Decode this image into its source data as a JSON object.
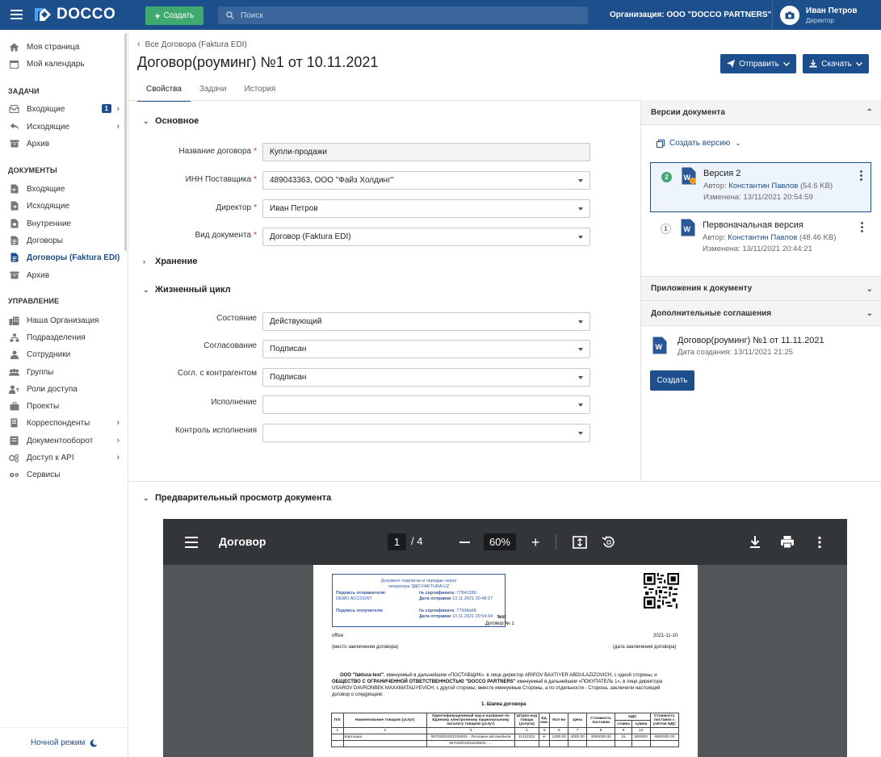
{
  "topbar": {
    "logo": "DOCCO",
    "create_label": "Создать",
    "search_placeholder": "Поиск",
    "org_label": "Организация: ООО \"DOCCO PARTNERS\"",
    "user_name": "Иван Петров",
    "user_role": "Директор"
  },
  "sidebar": {
    "top_items": [
      {
        "label": "Моя страница",
        "icon": "home-icon"
      },
      {
        "label": "Мой календарь",
        "icon": "calendar-icon"
      }
    ],
    "tasks_header": "ЗАДАЧИ",
    "tasks_items": [
      {
        "label": "Входящие",
        "icon": "inbox-icon",
        "badge": "1"
      },
      {
        "label": "Исходящие",
        "icon": "reply-icon"
      },
      {
        "label": "Архив",
        "icon": "archive-icon"
      }
    ],
    "docs_header": "ДОКУМЕНТЫ",
    "docs_items": [
      {
        "label": "Входящие",
        "icon": "doc-in-icon"
      },
      {
        "label": "Исходящие",
        "icon": "doc-out-icon"
      },
      {
        "label": "Внутренние",
        "icon": "doc-internal-icon"
      },
      {
        "label": "Договоры",
        "icon": "contract-icon"
      },
      {
        "label": "Договоры (Faktura EDI)",
        "icon": "contract-edi-icon",
        "active": true
      },
      {
        "label": "Архив",
        "icon": "archive-icon"
      }
    ],
    "mgmt_header": "УПРАВЛЕНИЕ",
    "mgmt_items": [
      {
        "label": "Наша Организация",
        "icon": "building-icon"
      },
      {
        "label": "Подразделения",
        "icon": "org-chart-icon"
      },
      {
        "label": "Сотрудники",
        "icon": "people-icon"
      },
      {
        "label": "Группы",
        "icon": "group-icon"
      },
      {
        "label": "Роли доступа",
        "icon": "role-icon"
      },
      {
        "label": "Проекты",
        "icon": "briefcase-icon"
      },
      {
        "label": "Корреспонденты",
        "icon": "correspondent-icon"
      },
      {
        "label": "Документооборот",
        "icon": "workflow-icon"
      },
      {
        "label": "Доступ к API",
        "icon": "api-icon"
      },
      {
        "label": "Сервисы",
        "icon": "services-icon"
      }
    ],
    "night_mode": "Ночной режим"
  },
  "header": {
    "breadcrumb": "Все Договора (Faktura EDI)",
    "title": "Договор(роуминг) №1 от 10.11.2021",
    "send_label": "Отправить",
    "download_label": "Скачать",
    "tabs": [
      "Свойства",
      "Задачи",
      "История"
    ]
  },
  "form": {
    "section_main": "Основное",
    "contract_name_label": "Название договора",
    "contract_name_value": "Купли-продажи",
    "inn_label": "ИНН Поставщика",
    "inn_value": "489043363, ООО \"Файз Холдинг\"",
    "director_label": "Директор",
    "director_value": "Иван Петров",
    "doctype_label": "Вид документа",
    "doctype_value": "Договор (Faktura EDI)",
    "section_storage": "Хранение",
    "section_lifecycle": "Жизненный цикл",
    "state_label": "Состояние",
    "state_value": "Действующий",
    "approval_label": "Согласование",
    "approval_value": "Подписан",
    "counterparty_label": "Согл. с контрагентом",
    "counterparty_value": "Подписан",
    "execution_label": "Исполнение",
    "execution_value": "",
    "control_label": "Контроль исполнения",
    "control_value": ""
  },
  "versions": {
    "header": "Версии документа",
    "create_version": "Создать версию",
    "items": [
      {
        "num": "2",
        "title": "Версия 2",
        "author_prefix": "Автор:",
        "author": "Константин Павлов",
        "size": "(54.6 KB)",
        "modified": "Изменена: 13/11/2021 20:54:59"
      },
      {
        "num": "1",
        "title": "Первоначальная версия",
        "author_prefix": "Автор:",
        "author": "Константин Павлов",
        "size": "(48.46 KB)",
        "modified": "Изменена: 13/11/2021 20:44:21"
      }
    ],
    "attachments_header": "Приложения к документу",
    "supplements_header": "Дополнительные соглашения",
    "supplement_title": "Договор(роуминг) №1 от 11.11.2021",
    "supplement_date": "Дата создания: 13/11/2021 21:25",
    "create_label": "Создать"
  },
  "preview": {
    "header": "Предварительный просмотр документа",
    "viewer_title": "Договор",
    "page": "1",
    "total_pages": "/ 4",
    "zoom": "60%",
    "doc": {
      "sig_head": "Документ подписан и передан через оператора ЭДО FAKTURA.UZ",
      "sender_label": "Подпись отправителя:",
      "sender_name": "DEMO ACCOUNT",
      "cert1_label": "№ сертификата:",
      "cert1": "77841289",
      "sent_label": "Дата отправки",
      "sent_date": "13.11.2021 20:48:37",
      "receiver_label": "Подпись получателя:",
      "cert2_label": "№ сертификата:",
      "cert2": "77934a68",
      "recv_label": "Дата отправки",
      "recv_date": "13.11.2021 20:54:34",
      "test": "test",
      "contract_no": "Договор № 1",
      "place": "office",
      "date": "2021-11-10",
      "place_caption": "(место заключения договора)",
      "date_caption": "(дата заключения договора)",
      "para_bold1": "ООО \"faktura-test\"",
      "para1": ", именуемый в дальнейшем «ПОСТАВЩИК», в лице директор ARIPOV BAXTIYER ABDULAZIZOVICH, с одной стороны, и",
      "para_bold2": "ОБЩЕСТВО С ОГРАНИЧЕННОЙ ОТВЕТСТВЕННОСТЬЮ \"DOCCO PARTNERS\"",
      "para2": " именуемый в дальнейшем «ПОКУПАТЕЛЬ 1», в лице директора USAROV DAVRONBEK MAXAMATALIYEVICH, с другой стороны, вместе именуемые Стороны, а по отдельности - Сторона, заключили настоящий договор о следующем:",
      "section": "1. Шапка договора",
      "table_headers": [
        "П/п",
        "Наименование товаров (услуг)",
        "Идентификационный код и название по Единому электронному национальному каталогу товаров (услуг)",
        "Штрих-код товара (услуги)",
        "Ед. изм.",
        "Кол-во",
        "Цена",
        "Стоимость поставки",
        "НДС",
        "Стоимость поставок с учётом НДС"
      ],
      "vat_sub": [
        "ставка",
        "сумма"
      ],
      "col_nums": [
        "1",
        "2",
        "3",
        "4",
        "5",
        "6",
        "7",
        "8",
        "9",
        "10"
      ],
      "row": [
        "",
        "Картошка",
        "06703001001028002 - Легковые автомобили",
        "11112222",
        "кг",
        "1000.00",
        "4000.00",
        "4000000.00",
        "15",
        "600000",
        "4600000.00"
      ],
      "row2_code": "06703001001028003 - ..."
    }
  }
}
